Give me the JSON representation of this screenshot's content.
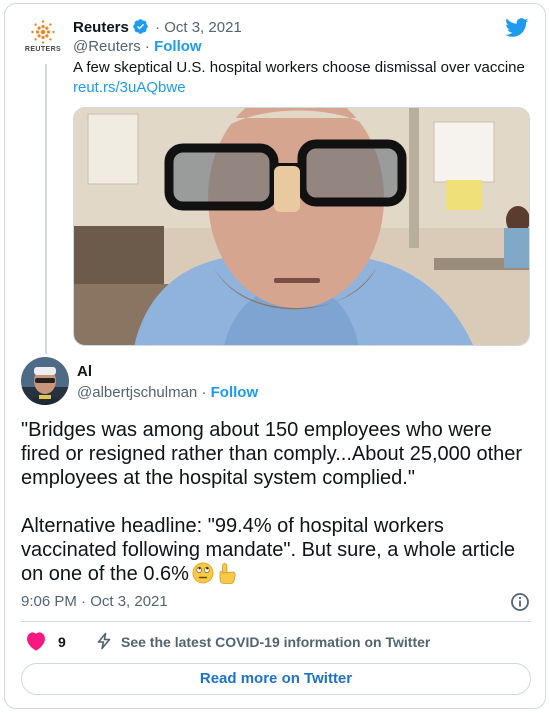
{
  "quoted_tweet": {
    "author_name": "Reuters",
    "logo_text": "REUTERS",
    "date": "Oct 3, 2021",
    "handle": "@Reuters",
    "follow_label": "Follow",
    "text": "A few skeptical U.S. hospital workers choose dismissal over vaccine",
    "link": "reut.rs/3uAQbwe"
  },
  "tweet": {
    "author_name": "Al",
    "handle": "@albertjschulman",
    "follow_label": "Follow",
    "paragraph_1": "\"Bridges was among about 150 employees who were fired or resigned rather than comply...About 25,000 other employees at the hospital system complied.\"",
    "paragraph_2": "Alternative headline: \"99.4% of hospital workers vaccinated following mandate\". But sure, a whole article on one of the 0.6%",
    "timestamp": "9:06 PM · Oct 3, 2021"
  },
  "actions": {
    "like_count": "9",
    "covid_info": "See the latest COVID-19 information on Twitter"
  },
  "read_more_label": "Read more on Twitter",
  "icons": {
    "verified": "verified-badge-icon",
    "platform": "twitter-bird-icon",
    "like": "heart-icon",
    "covid": "lightning-icon",
    "info": "info-icon"
  },
  "colors": {
    "accent": "#1d9bf0",
    "like": "#f91880",
    "text": "#0f1419",
    "muted": "#536471",
    "border": "#cfd9de"
  }
}
